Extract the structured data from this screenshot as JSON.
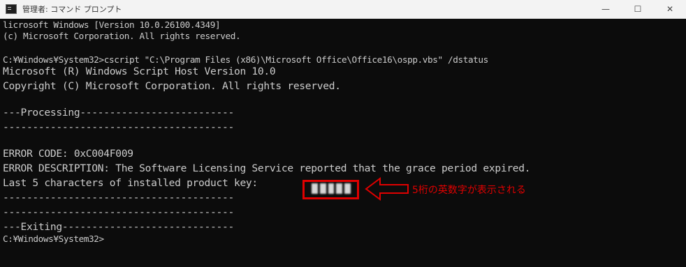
{
  "window": {
    "title": "管理者: コマンド プロンプト",
    "controls": {
      "minimize": "—",
      "maximize": "☐",
      "close": "✕"
    }
  },
  "terminal": {
    "lines": [
      "licrosoft Windows [Version 10.0.26100.4349]",
      "(c) Microsoft Corporation. All rights reserved.",
      "",
      "C:¥Windows¥System32>cscript \"C:\\Program Files (x86)\\Microsoft Office\\Office16\\ospp.vbs\" /dstatus",
      "Microsoft (R) Windows Script Host Version 10.0",
      "Copyright (C) Microsoft Corporation. All rights reserved.",
      "",
      "---Processing--------------------------",
      "---------------------------------------",
      "",
      "ERROR CODE: 0xC004F009",
      "ERROR DESCRIPTION: The Software Licensing Service reported that the grace period expired.",
      "Last 5 characters of installed product key:",
      "---------------------------------------",
      "---------------------------------------",
      "---Exiting-----------------------------",
      "C:¥Windows¥System32>"
    ]
  },
  "annotation": {
    "text": "5桁の英数字が表示される",
    "color": "#e00000"
  },
  "colors": {
    "terminal_bg": "#0c0c0c",
    "terminal_fg": "#cccccc",
    "titlebar_bg": "#f3f3f3"
  },
  "icons": {
    "app": "console-icon",
    "arrow": "arrow-left-icon"
  }
}
